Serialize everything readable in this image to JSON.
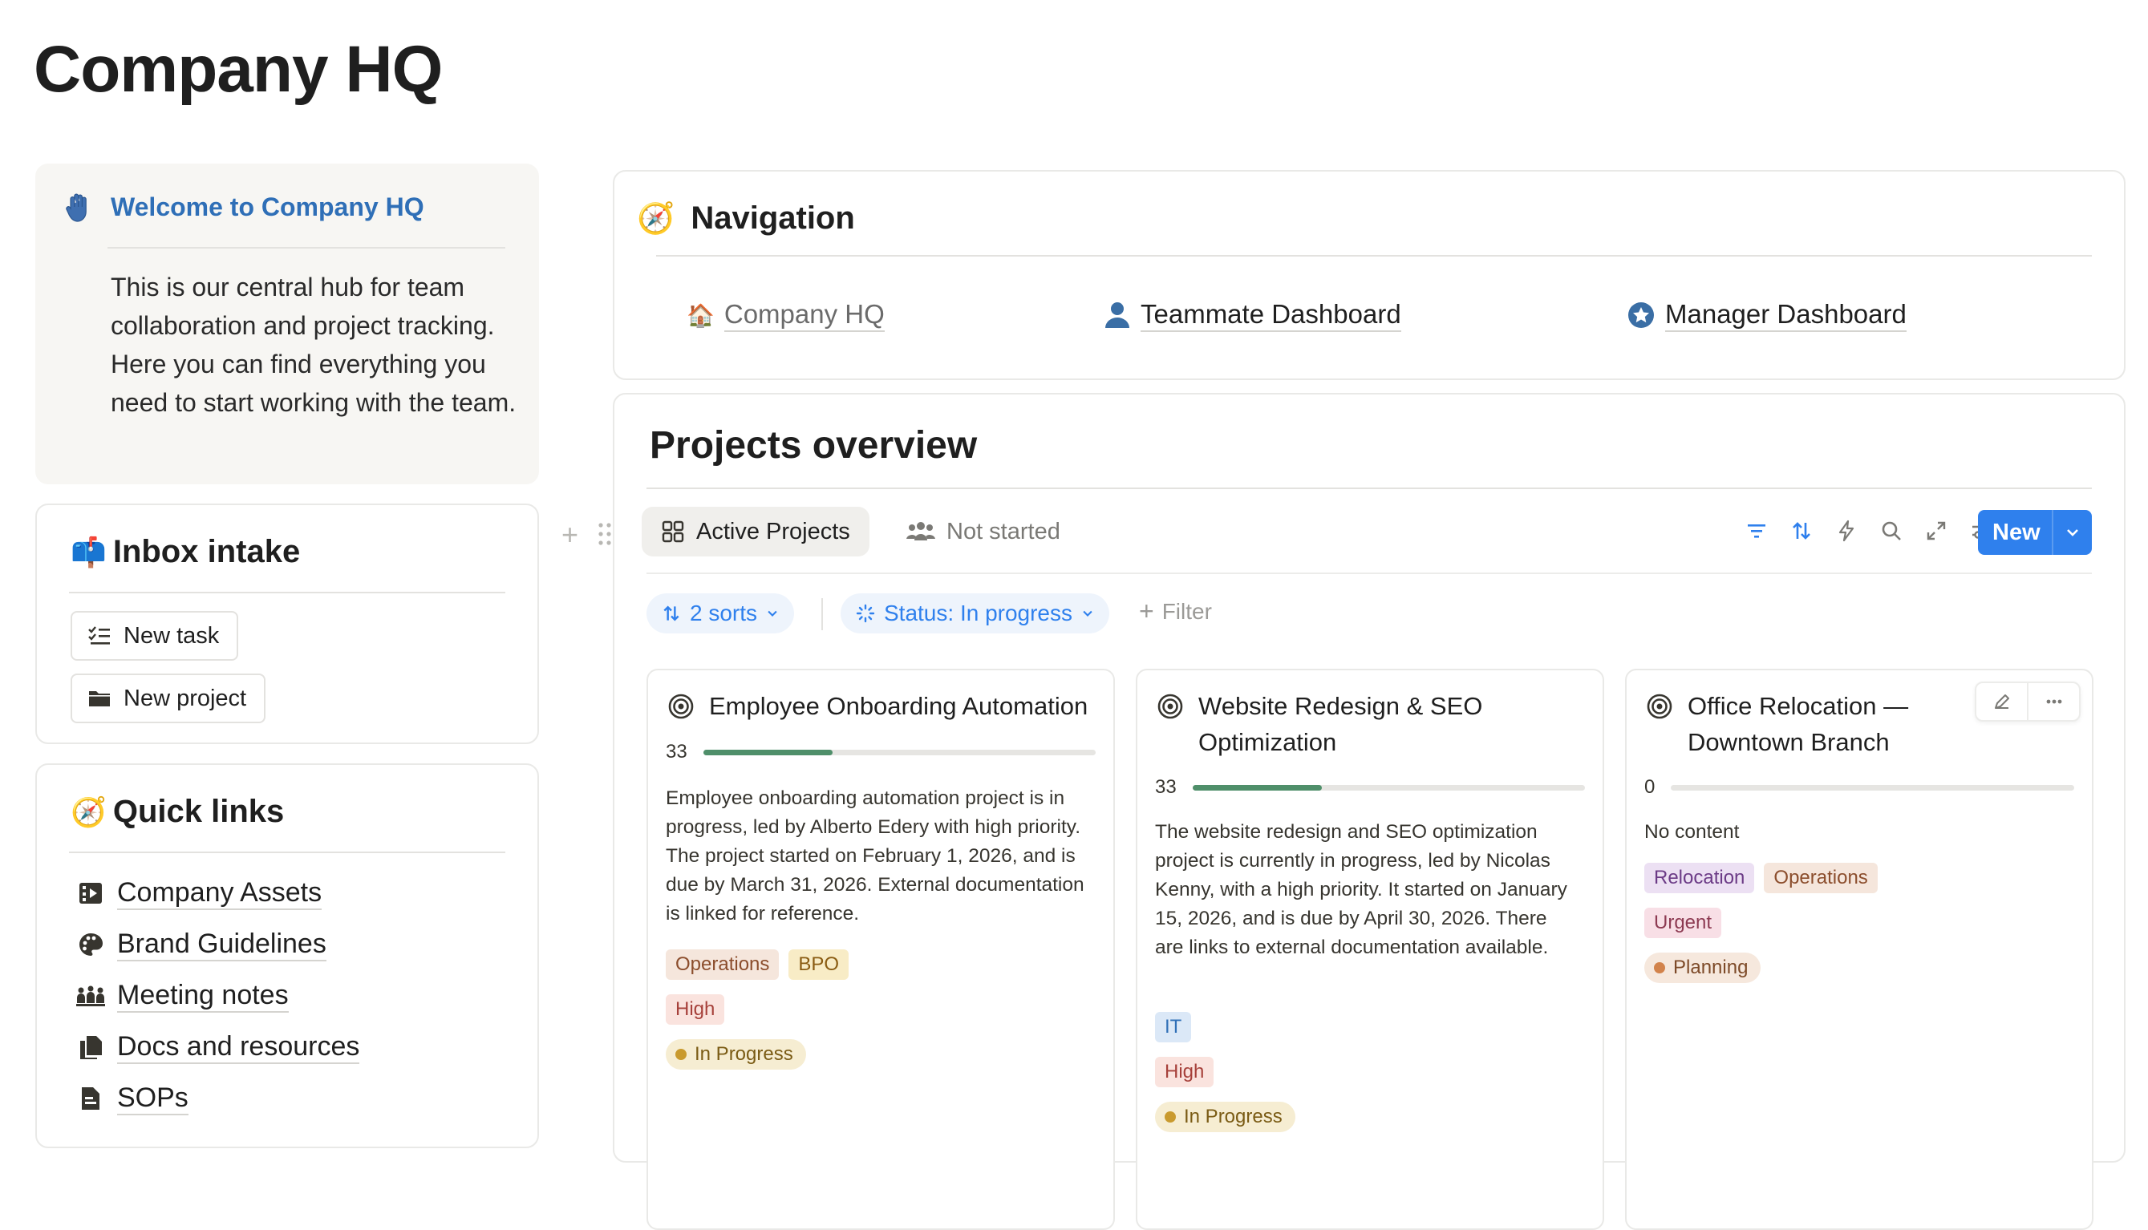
{
  "page": {
    "title": "Company HQ"
  },
  "welcome": {
    "title": "Welcome to Company HQ",
    "body": "This is our central hub for team collaboration and project tracking. Here you can find everything you need to start working with the team."
  },
  "inbox": {
    "emoji": "📫",
    "title": "Inbox intake",
    "buttons": [
      {
        "label": "New task",
        "icon": "checklist-icon"
      },
      {
        "label": "New project",
        "icon": "folder-icon"
      }
    ]
  },
  "quick_links": {
    "emoji": "🧭",
    "title": "Quick links",
    "items": [
      {
        "label": "Company Assets",
        "icon": "film-icon"
      },
      {
        "label": "Brand Guidelines",
        "icon": "palette-icon"
      },
      {
        "label": "Meeting notes",
        "icon": "people-meeting-icon"
      },
      {
        "label": "Docs and resources",
        "icon": "documents-icon"
      },
      {
        "label": "SOPs",
        "icon": "sop-document-icon"
      }
    ]
  },
  "navigation": {
    "emoji": "🧭",
    "title": "Navigation",
    "links": [
      {
        "emoji": "🏠",
        "label": "Company HQ"
      },
      {
        "label": "Teammate Dashboard",
        "icon": "person-icon"
      },
      {
        "label": "Manager Dashboard",
        "icon": "star-badge-icon"
      }
    ]
  },
  "projects": {
    "title": "Projects overview",
    "tabs": [
      {
        "label": "Active Projects",
        "icon": "grid-icon",
        "active": true
      },
      {
        "label": "Not started",
        "icon": "people-icon",
        "active": false
      }
    ],
    "new_button": "New",
    "sorts_chip": "2 sorts",
    "status_chip": "Status: In progress",
    "filter_label": "Filter",
    "accent": "#2f80ed",
    "cards": [
      {
        "title": "Employee Onboarding Automation",
        "progress": 33,
        "progress_label": "33",
        "description": "Employee onboarding automation project is in progress, led by Alberto Edery with high priority. The project started on February 1, 2026, and is due by March 31, 2026. External documentation is linked for reference.",
        "tags": [
          "Operations",
          "BPO"
        ],
        "priority": "High",
        "status": "In Progress"
      },
      {
        "title": "Website Redesign & SEO Optimization",
        "progress": 33,
        "progress_label": "33",
        "description": "The website redesign and SEO optimization project is currently in progress, led by Nicolas Kenny, with a high priority. It started on January 15, 2026, and is due by April 30, 2026. There are links to external documentation available.",
        "tags": [
          "IT"
        ],
        "priority": "High",
        "status": "In Progress"
      },
      {
        "title": "Office Relocation — Downtown Branch",
        "progress": 0,
        "progress_label": "0",
        "description": "No content",
        "tags": [
          "Relocation",
          "Operations"
        ],
        "priority": "Urgent",
        "status": "Planning"
      }
    ]
  }
}
